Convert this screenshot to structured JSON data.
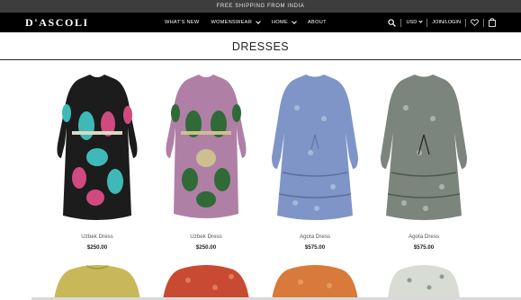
{
  "promo_bar": {
    "text": "FREE SHIPPING FROM INDIA"
  },
  "header": {
    "logo": "D'ASCOLI",
    "nav": [
      {
        "label": "WHAT'S NEW",
        "has_dropdown": false
      },
      {
        "label": "WOMENSWEAR",
        "has_dropdown": true
      },
      {
        "label": "HOME",
        "has_dropdown": true
      },
      {
        "label": "ABOUT",
        "has_dropdown": false
      }
    ],
    "currency": "USD",
    "account_label": "JOIN/LOGIN",
    "icons": [
      "search-icon",
      "heart-icon",
      "bag-icon"
    ]
  },
  "page": {
    "title": "DRESSES"
  },
  "products": [
    {
      "name": "Uzbek Dress",
      "price": "$250.00",
      "palette": [
        "#1c1c1c",
        "#3fb9b8",
        "#d0497f"
      ]
    },
    {
      "name": "Uzbek Dress",
      "price": "$250.00",
      "palette": [
        "#b07fa6",
        "#2f6a37",
        "#cdbf90"
      ]
    },
    {
      "name": "Agota Dress",
      "price": "$575.00",
      "palette": [
        "#7f95c7",
        "#a6b7dc",
        "#5a6f9f"
      ]
    },
    {
      "name": "Agota Dress",
      "price": "$575.00",
      "palette": [
        "#7b857d",
        "#a9b3aa",
        "#4f5951"
      ]
    }
  ],
  "partial_row": [
    {
      "palette": [
        "#c9b85a",
        "#9ea346"
      ]
    },
    {
      "palette": [
        "#c84a32",
        "#e07b55"
      ]
    },
    {
      "palette": [
        "#d77a3c",
        "#e89a5c"
      ]
    },
    {
      "palette": [
        "#d9dcd4",
        "#8aa087"
      ]
    }
  ],
  "colors": {
    "promo_bg": "#3d3d3d",
    "nav_bg": "#000000",
    "text": "#222222"
  }
}
